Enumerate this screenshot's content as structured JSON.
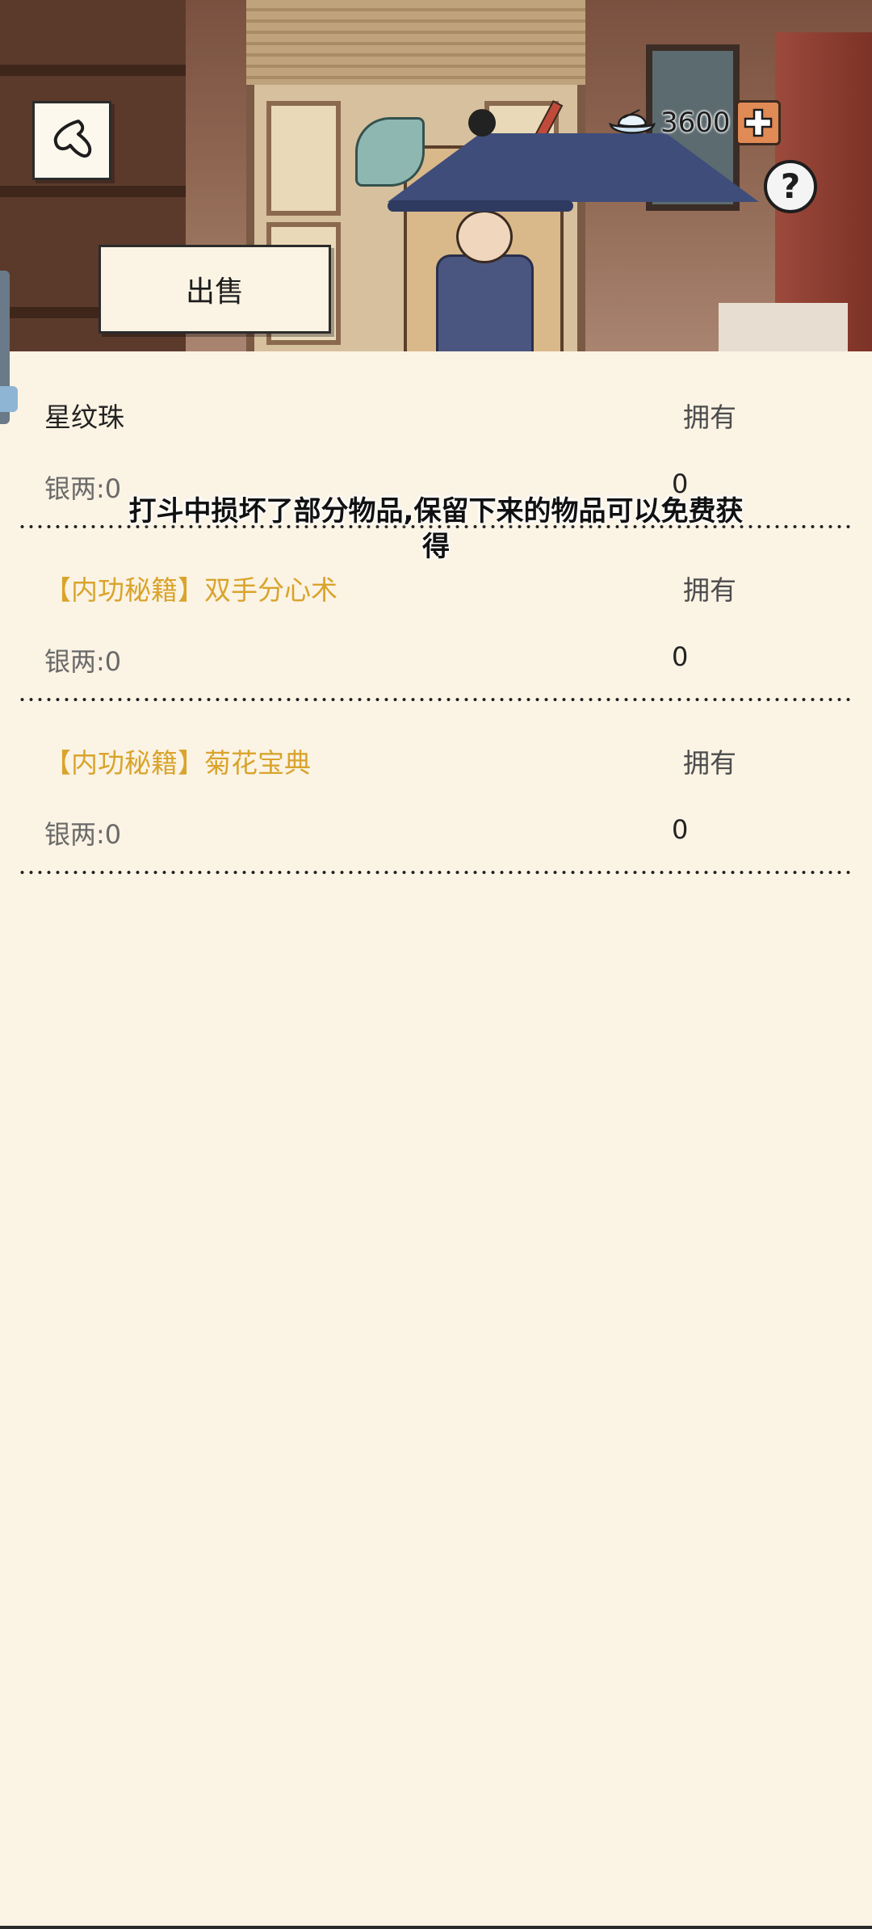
{
  "header": {
    "currency_value": "3600",
    "sell_label": "出售",
    "icons": {
      "back": "back-chevron-icon",
      "currency": "silver-ingot-icon",
      "add": "plus-icon",
      "help": "question-icon"
    },
    "help_glyph": "?"
  },
  "items": [
    {
      "name": "星纹珠",
      "own_label": "拥有",
      "price": "银两:0",
      "count": "0",
      "name_color": "#222222"
    },
    {
      "name": "【内功秘籍】双手分心术",
      "own_label": "拥有",
      "price": "银两:0",
      "count": "0",
      "name_color": "#d9a42c"
    },
    {
      "name": "【内功秘籍】菊花宝典",
      "own_label": "拥有",
      "price": "银两:0",
      "count": "0",
      "name_color": "#d9a42c"
    }
  ],
  "toast": {
    "line1": "打斗中损坏了部分物品,保留下来的物品可以免费获",
    "line2": "得"
  }
}
